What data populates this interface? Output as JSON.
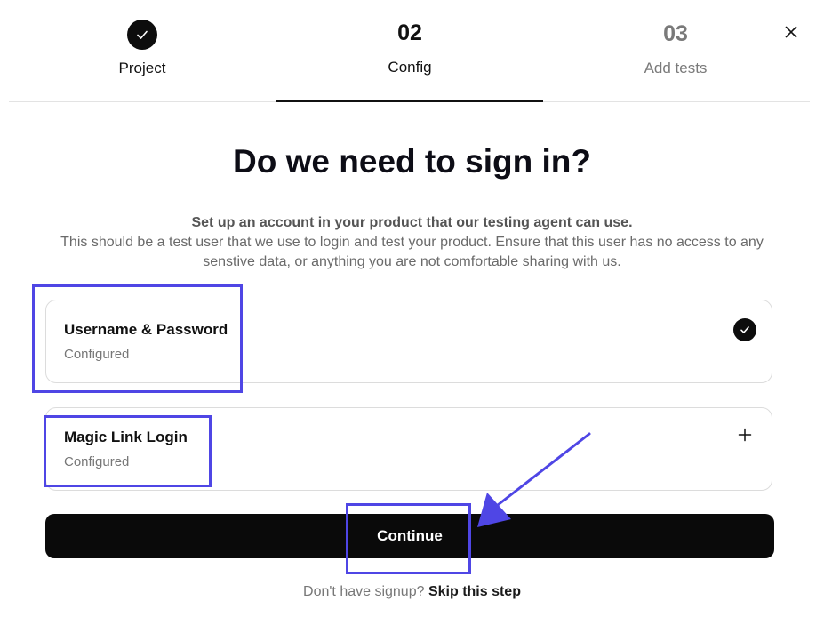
{
  "stepper": {
    "steps": [
      {
        "number": "",
        "label": "Project",
        "state": "completed"
      },
      {
        "number": "02",
        "label": "Config",
        "state": "active"
      },
      {
        "number": "03",
        "label": "Add tests",
        "state": "upcoming"
      }
    ]
  },
  "main": {
    "title": "Do we need to sign in?",
    "subtitle": "Set up an account in your product that our testing agent can use.",
    "description": "This should be a test user that we use to login and test your product. Ensure that this user has no access to any senstive data, or anything you are not comfortable sharing with us."
  },
  "auth_options": [
    {
      "title": "Username & Password",
      "status": "Configured",
      "icon": "check-circle-icon"
    },
    {
      "title": "Magic Link Login",
      "status": "Configured",
      "icon": "plus-icon"
    }
  ],
  "actions": {
    "continue_label": "Continue",
    "skip_prompt": "Don't have signup?",
    "skip_link": "Skip this step"
  },
  "colors": {
    "annotation": "#4f46e5",
    "primary_button": "#0a0a0a",
    "muted_text": "#777777"
  }
}
